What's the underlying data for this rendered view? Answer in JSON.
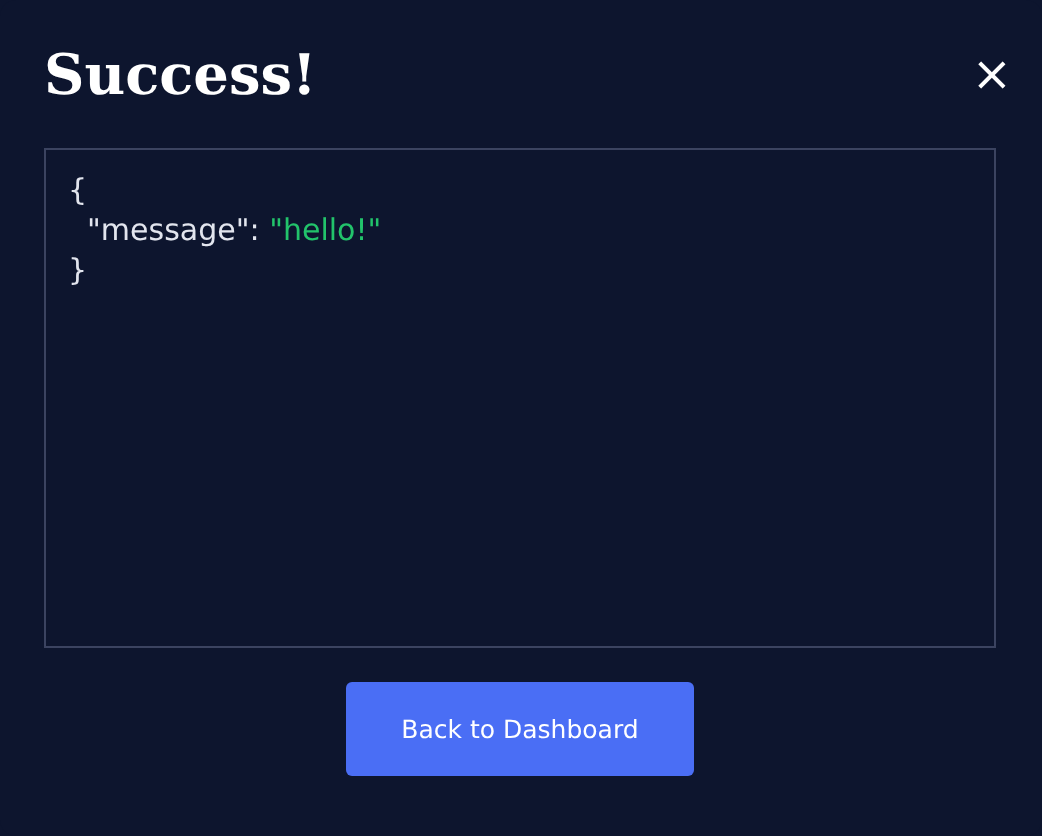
{
  "dialog": {
    "title": "Success!",
    "close": "×"
  },
  "response": {
    "lines": [
      [
        {
          "kind": "punct",
          "text": "{"
        }
      ],
      [
        {
          "kind": "key",
          "text": "  \"message\": "
        },
        {
          "kind": "string",
          "text": "\"hello!\""
        }
      ],
      [
        {
          "kind": "punct",
          "text": "}"
        }
      ]
    ]
  },
  "button": {
    "label": "Back to Dashboard"
  }
}
